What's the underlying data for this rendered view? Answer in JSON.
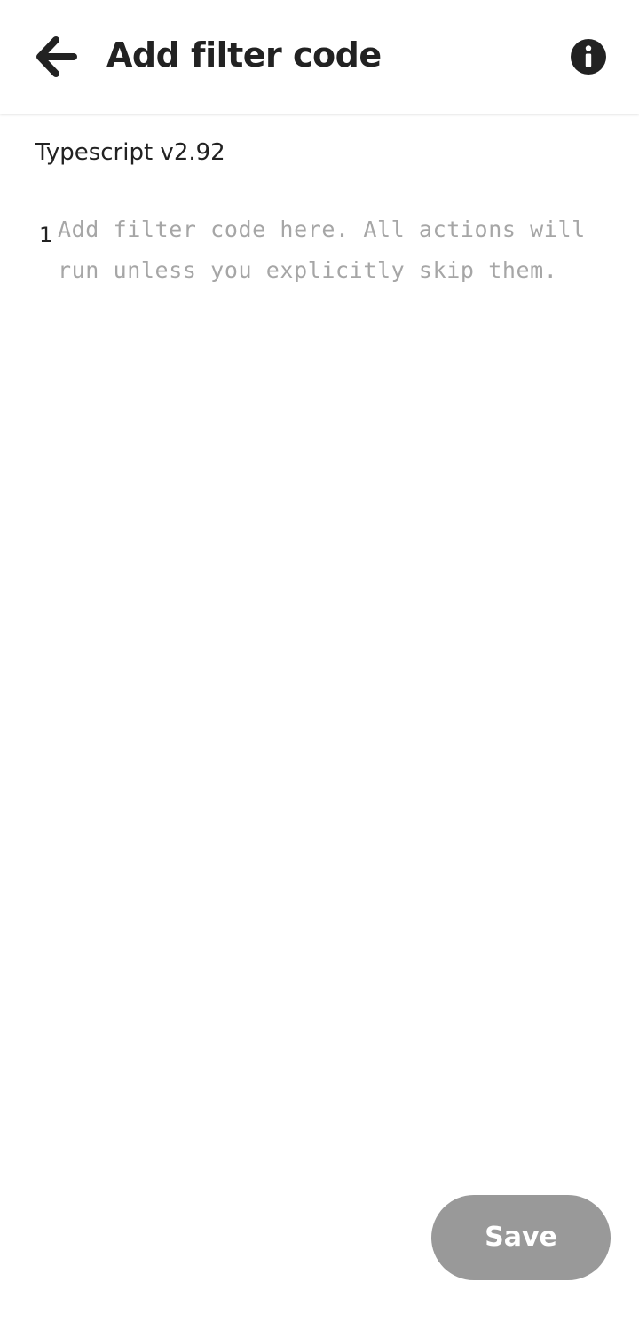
{
  "header": {
    "title": "Add filter code",
    "back_icon": "arrow-left-icon",
    "info_icon": "info-circle-icon"
  },
  "editor": {
    "language_label": "Typescript v2.92",
    "line_number": "1",
    "placeholder": "Add filter code here. All actions will run unless you explicitly skip them."
  },
  "footer": {
    "save_label": "Save"
  },
  "colors": {
    "text": "#222222",
    "placeholder": "#a6a6a6",
    "save_button_disabled": "#999999",
    "background": "#ffffff"
  }
}
